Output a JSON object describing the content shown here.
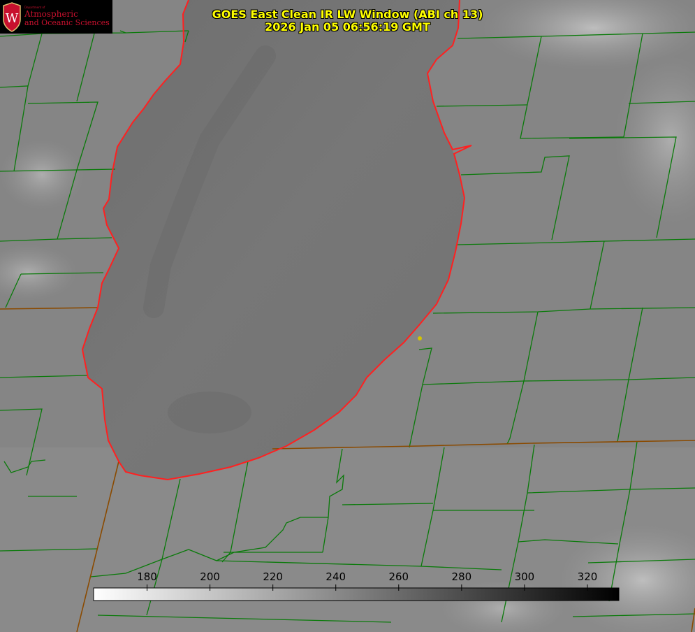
{
  "title": {
    "line1": "GOES East Clean IR LW Window (ABI ch 13)",
    "line2": "2026 Jan 05 06:56:19 GMT"
  },
  "logo": {
    "department": "Department of",
    "line1": "Atmospheric",
    "line2": "and Oceanic Sciences",
    "seal_letter": "W",
    "color": "#c8102e"
  },
  "colorbar": {
    "ticks": [
      "180",
      "200",
      "220",
      "240",
      "260",
      "280",
      "300",
      "320"
    ],
    "tick_values": [
      180,
      200,
      220,
      240,
      260,
      280,
      300,
      320
    ],
    "min": 163,
    "max": 330,
    "gradient": [
      "#ffffff",
      "#000000"
    ]
  },
  "colors": {
    "county_lines": "#0a7a0a",
    "state_lines": "#8a4a00",
    "lakeshore": "#ff2020",
    "title": "#ffff00",
    "marker": "#d4c400"
  }
}
